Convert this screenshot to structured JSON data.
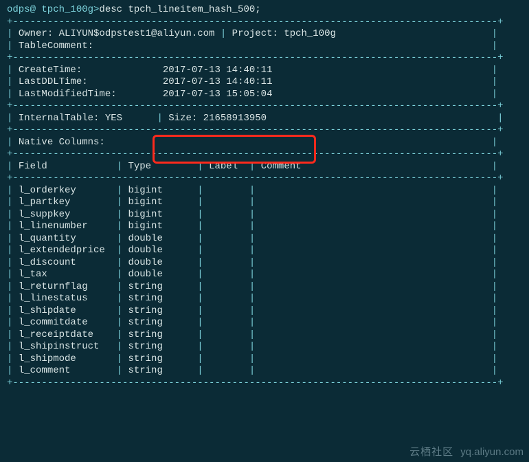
{
  "prompt": {
    "prefix": "odps@ tpch_100g>",
    "command": "desc tpch_lineitem_hash_500;"
  },
  "header": {
    "owner_label": "Owner:",
    "owner": "ALIYUN$odpstest1@aliyun.com",
    "project_label": "Project:",
    "project": "tpch_100g",
    "table_comment_label": "TableComment:"
  },
  "times": {
    "create_label": "CreateTime:",
    "create": "2017-07-13 14:40:11",
    "ddl_label": "LastDDLTime:",
    "ddl": "2017-07-13 14:40:11",
    "mod_label": "LastModifiedTime:",
    "mod": "2017-07-13 15:05:04"
  },
  "flags": {
    "internal_label": "InternalTable:",
    "internal": "YES",
    "size_label": "Size:",
    "size": "21658913950"
  },
  "columns_header": "Native Columns:",
  "table_head": {
    "field": "Field",
    "type": "Type",
    "label": "Label",
    "comment": "Comment"
  },
  "columns": [
    {
      "name": "l_orderkey",
      "type": "bigint"
    },
    {
      "name": "l_partkey",
      "type": "bigint"
    },
    {
      "name": "l_suppkey",
      "type": "bigint"
    },
    {
      "name": "l_linenumber",
      "type": "bigint"
    },
    {
      "name": "l_quantity",
      "type": "double"
    },
    {
      "name": "l_extendedprice",
      "type": "double"
    },
    {
      "name": "l_discount",
      "type": "double"
    },
    {
      "name": "l_tax",
      "type": "double"
    },
    {
      "name": "l_returnflag",
      "type": "string"
    },
    {
      "name": "l_linestatus",
      "type": "string"
    },
    {
      "name": "l_shipdate",
      "type": "string"
    },
    {
      "name": "l_commitdate",
      "type": "string"
    },
    {
      "name": "l_receiptdate",
      "type": "string"
    },
    {
      "name": "l_shipinstruct",
      "type": "string"
    },
    {
      "name": "l_shipmode",
      "type": "string"
    },
    {
      "name": "l_comment",
      "type": "string"
    }
  ],
  "watermark": {
    "zh": "云栖社区",
    "url": "yq.aliyun.com"
  },
  "sep_major": "+------------------------------------------------------------------------------------+",
  "sep_split": "+------------------------------------------------------------------------------------+",
  "sep_cols": "+------------------------------------------------------------------------------------+"
}
